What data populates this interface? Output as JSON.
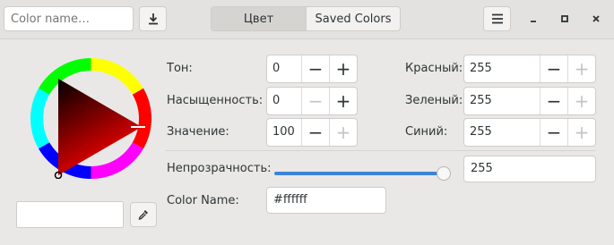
{
  "header": {
    "search_placeholder": "Color name…",
    "tabs": [
      {
        "label": "Цвет",
        "active": true
      },
      {
        "label": "Saved Colors",
        "active": false
      }
    ]
  },
  "color": {
    "hue_label": "Тон:",
    "hue_value": "0",
    "saturation_label": "Насыщенность:",
    "saturation_value": "0",
    "value_label": "Значение:",
    "value_value": "100",
    "red_label": "Красный:",
    "red_value": "255",
    "green_label": "Зеленый:",
    "green_value": "255",
    "blue_label": "Синий:",
    "blue_value": "255",
    "opacity_label": "Непрозрачность:",
    "opacity_value": "255",
    "opacity_fraction": 1.0,
    "name_label": "Color Name:",
    "name_value": "#ffffff",
    "preview_color": "#ffffff",
    "wheel_hue_color": "#ff0000"
  },
  "icons": [
    "download-icon",
    "menu-icon",
    "minimize-icon",
    "maximize-icon",
    "close-icon",
    "eyedropper-icon",
    "minus-icon",
    "plus-icon"
  ]
}
